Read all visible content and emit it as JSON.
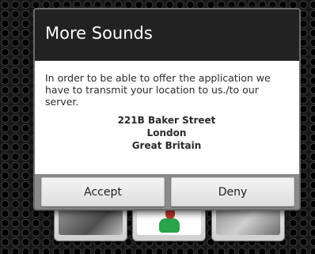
{
  "dialog": {
    "title": "More Sounds",
    "message": "In order to be able to offer the application we have to transmit your location to us./to our server.",
    "address": {
      "street": "221B Baker Street",
      "city": "London",
      "country": "Great Britain"
    },
    "buttons": {
      "accept": "Accept",
      "deny": "Deny"
    }
  },
  "colors": {
    "title_text": "#ffffff",
    "dialog_dark": "#1b1b1b",
    "body_bg": "#ffffff",
    "button_bar": "#8a8a8a"
  }
}
